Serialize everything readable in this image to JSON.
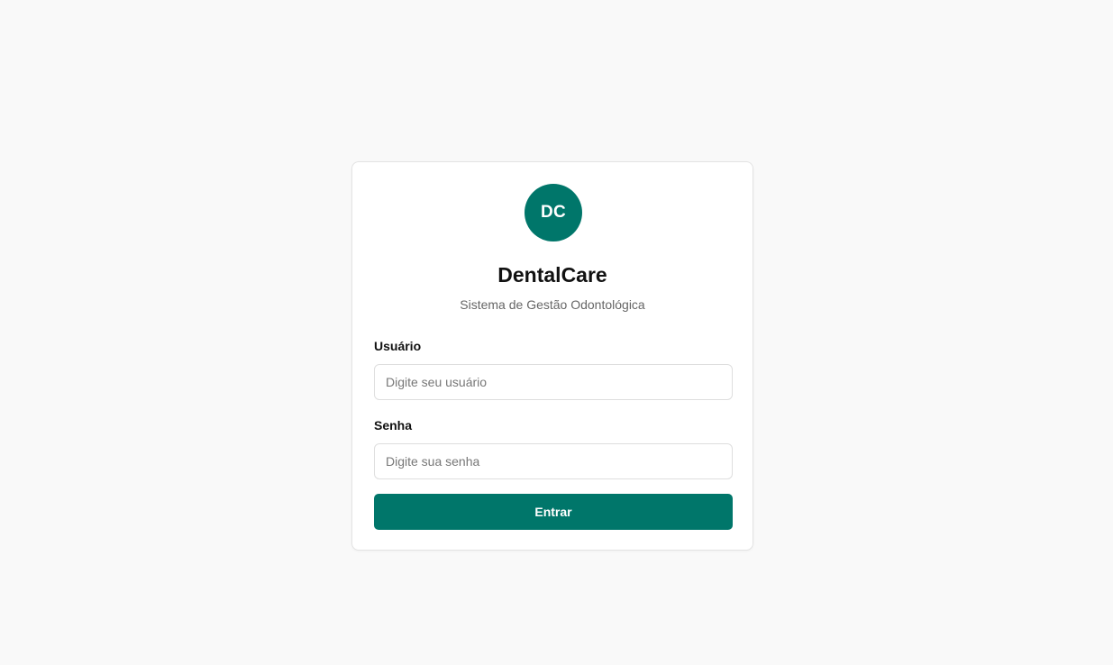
{
  "logo": {
    "initials": "DC",
    "color": "#00766a"
  },
  "app": {
    "title": "DentalCare",
    "subtitle": "Sistema de Gestão Odontológica"
  },
  "form": {
    "username": {
      "label": "Usuário",
      "placeholder": "Digite seu usuário",
      "value": ""
    },
    "password": {
      "label": "Senha",
      "placeholder": "Digite sua senha",
      "value": ""
    },
    "submit_label": "Entrar"
  },
  "colors": {
    "accent": "#00766a",
    "background": "#f9f9f9",
    "card": "#ffffff"
  }
}
